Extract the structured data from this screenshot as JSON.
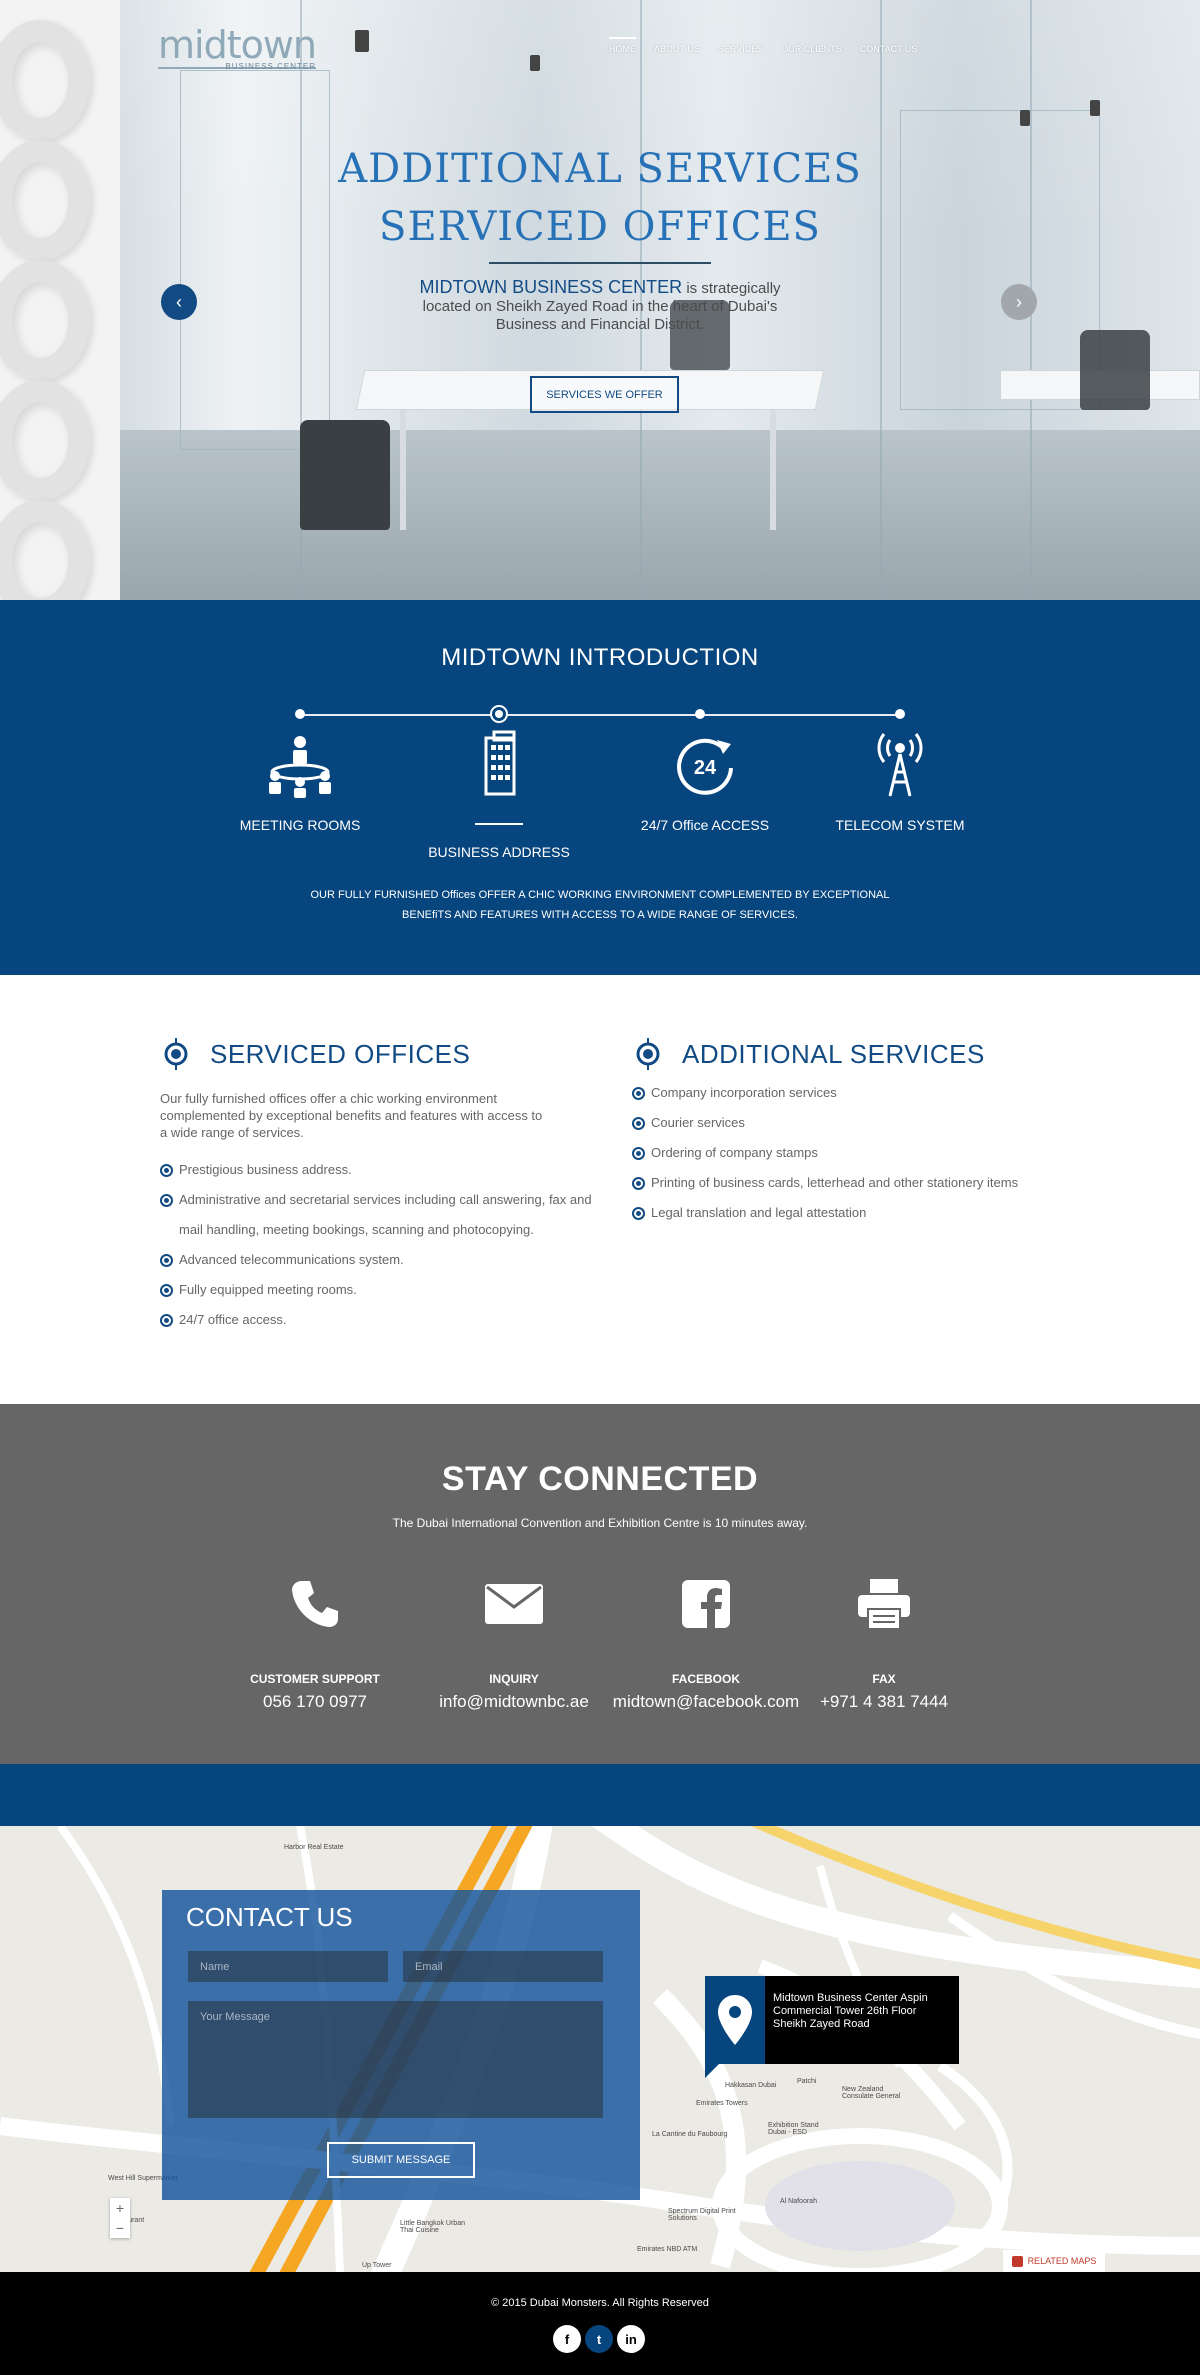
{
  "header": {
    "logo_text": "midtown",
    "logo_sub": "BUSINESS CENTER",
    "nav": [
      "HOME",
      "ABOUT US",
      "SERVICES",
      "OUR CLIENTS",
      "CONTACT US"
    ]
  },
  "hero": {
    "title_line1": "ADDITIONAL SERVICES",
    "title_line2": "SERVICED OFFICES",
    "desc_highlight": "MIDTOWN BUSINESS CENTER",
    "desc_rest": " is strategically located on Sheikh Zayed Road in the heart of Dubai's Business and Financial District.",
    "button": "SERVICES WE OFFER",
    "prev": "‹",
    "next": "›"
  },
  "intro": {
    "title": "MIDTOWN INTRODUCTION",
    "features": [
      "MEETING ROOMS",
      "BUSINESS ADDRESS",
      "24/7 Office ACCESS",
      "TELECOM SYSTEM"
    ],
    "clock_text": "24",
    "description": "OUR FULLY FURNISHED Offices OFFER A CHIC WORKING ENVIRONMENT COMPLEMENTED BY EXCEPTIONAL BENEfiTS AND FEATURES WITH ACCESS TO A WIDE RANGE OF SERVICES."
  },
  "serviced": {
    "title": "SERVICED OFFICES",
    "lead": "Our fully furnished offices offer a chic working environment complemented by exceptional benefits and features with access to a wide range of services.",
    "items": [
      "Prestigious business address.",
      "Administrative and secretarial services including call answering, fax and mail handling, meeting bookings, scanning and photocopying.",
      "Advanced telecommunications system.",
      "Fully equipped meeting rooms.",
      "24/7 office access."
    ]
  },
  "additional": {
    "title": "ADDITIONAL SERVICES",
    "items": [
      "Company incorporation services",
      "Courier services",
      "Ordering of company stamps",
      "Printing of business cards, letterhead and other stationery items",
      "Legal translation and legal attestation"
    ]
  },
  "stay": {
    "title": "STAY CONNECTED",
    "subtitle": "The Dubai International Convention and Exhibition Centre is 10 minutes away.",
    "contacts": [
      {
        "label": "CUSTOMER SUPPORT",
        "value": "056 170 0977",
        "icon": "phone-icon"
      },
      {
        "label": "INQUIRY",
        "value": "info@midtownbc.ae",
        "icon": "envelope-icon"
      },
      {
        "label": "FACEBOOK",
        "value": "midtown@facebook.com",
        "icon": "facebook-icon"
      },
      {
        "label": "FAX",
        "value": "+971 4 381 7444",
        "icon": "printer-icon"
      }
    ]
  },
  "map": {
    "places": [
      "Harbor Real Estate",
      "Emirates Towers",
      "Hakkasan Dubai",
      "Patchi",
      "New Zealand Consulate General",
      "Exhibition Stand Dubai - ESD",
      "La Cantine du Faubourg",
      "Al Nafoorah",
      "Spectrum Digital Print Solutions",
      "Emirates NBD ATM",
      "Little Bangkok Urban Thai Cuisine",
      "West Hill Supermarket",
      "Restaurant",
      "Up Tower"
    ],
    "marker_text": "Midtown Business Center Aspin Commercial Tower 26th  Floor Sheikh Zayed Road",
    "zoom_in": "+",
    "zoom_out": "−",
    "related": "RELATED MAPS"
  },
  "contact_form": {
    "title": "CONTACT US",
    "name_placeholder": "Name",
    "email_placeholder": "Email",
    "message_placeholder": "Your Message",
    "submit": "SUBMIT MESSAGE"
  },
  "footer": {
    "copyright": "© 2015 Dubai Monsters. All Rights Reserved",
    "socials": [
      "f",
      "t",
      "in"
    ]
  },
  "colors": {
    "brand_blue": "#07457e",
    "accent_blue": "#2771b7",
    "gray_band": "#666666"
  }
}
